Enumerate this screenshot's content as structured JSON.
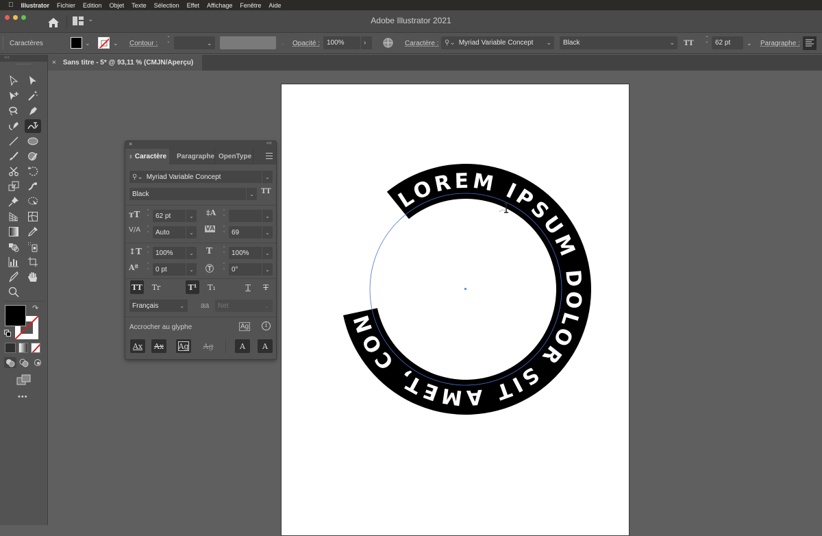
{
  "menubar": {
    "apple": "",
    "items": [
      "Illustrator",
      "Fichier",
      "Edition",
      "Objet",
      "Texte",
      "Sélection",
      "Effet",
      "Affichage",
      "Fenêtre",
      "Aide"
    ]
  },
  "window": {
    "title": "Adobe Illustrator 2021"
  },
  "control_bar": {
    "section_label": "Caractères",
    "stroke_label": "Contour :",
    "stroke_weight": "",
    "opacity_label": "Opacité :",
    "opacity_value": "100%",
    "character_label": "Caractère :",
    "font_family": "Myriad Variable Concept",
    "font_style": "Black",
    "font_size": "62 pt",
    "paragraph_label": "Paragraphe :"
  },
  "document_tab": {
    "close": "×",
    "title": "Sans titre - 5* @ 93,11 % (CMJN/Aperçu)"
  },
  "toolbar": {
    "collapse": "<<",
    "fill_color": "#000000",
    "stroke_color": "none",
    "more": "•••",
    "tools": [
      "selection-tool",
      "direct-selection-tool",
      "group-selection-tool",
      "magic-wand-tool",
      "lasso-tool",
      "pen-tool",
      "curvature-tool",
      "type-on-path-tool",
      "line-tool",
      "ellipse-tool",
      "paintbrush-tool",
      "shaper-tool",
      "scissors-tool",
      "rotate-tool",
      "scale-tool",
      "warp-tool",
      "puppet-warp-tool",
      "free-transform-tool",
      "perspective-grid-tool",
      "mesh-tool",
      "gradient-tool",
      "eyedropper-tool",
      "shape-builder-tool",
      "symbol-sprayer-tool",
      "column-graph-tool",
      "artboard-tool",
      "slice-tool",
      "hand-tool",
      "zoom-tool"
    ],
    "active_tool": "type-on-path-tool"
  },
  "character_panel": {
    "close": "×",
    "collapse": "<<",
    "tabs": [
      {
        "label": "Caractère",
        "active": true
      },
      {
        "label": "Paragraphe",
        "active": false
      },
      {
        "label": "OpenType",
        "active": false
      }
    ],
    "font_family": "Myriad Variable Concept",
    "font_style": "Black",
    "font_size": "62 pt",
    "leading": "",
    "kerning": "Auto",
    "tracking": "69",
    "vertical_scale": "100%",
    "horizontal_scale": "100%",
    "baseline_shift": "0 pt",
    "character_rotation": "0°",
    "style_buttons": [
      "TT",
      "Tr",
      "T¹",
      "T₁",
      "T",
      "T"
    ],
    "language": "Français",
    "antialiasing_label": "aa",
    "antialiasing": "Net",
    "snap_label": "Accrocher au glyphe",
    "snap_buttons": [
      "Ax",
      "Ax",
      "Ag",
      "Ag",
      "A",
      "A"
    ]
  },
  "artwork": {
    "path_text": "LOREM IPSUM DOLOR SIT AMET, CONSECTETUER",
    "ring_color": "#000000",
    "text_color": "#ffffff",
    "path_color": "#4a6fd8"
  }
}
